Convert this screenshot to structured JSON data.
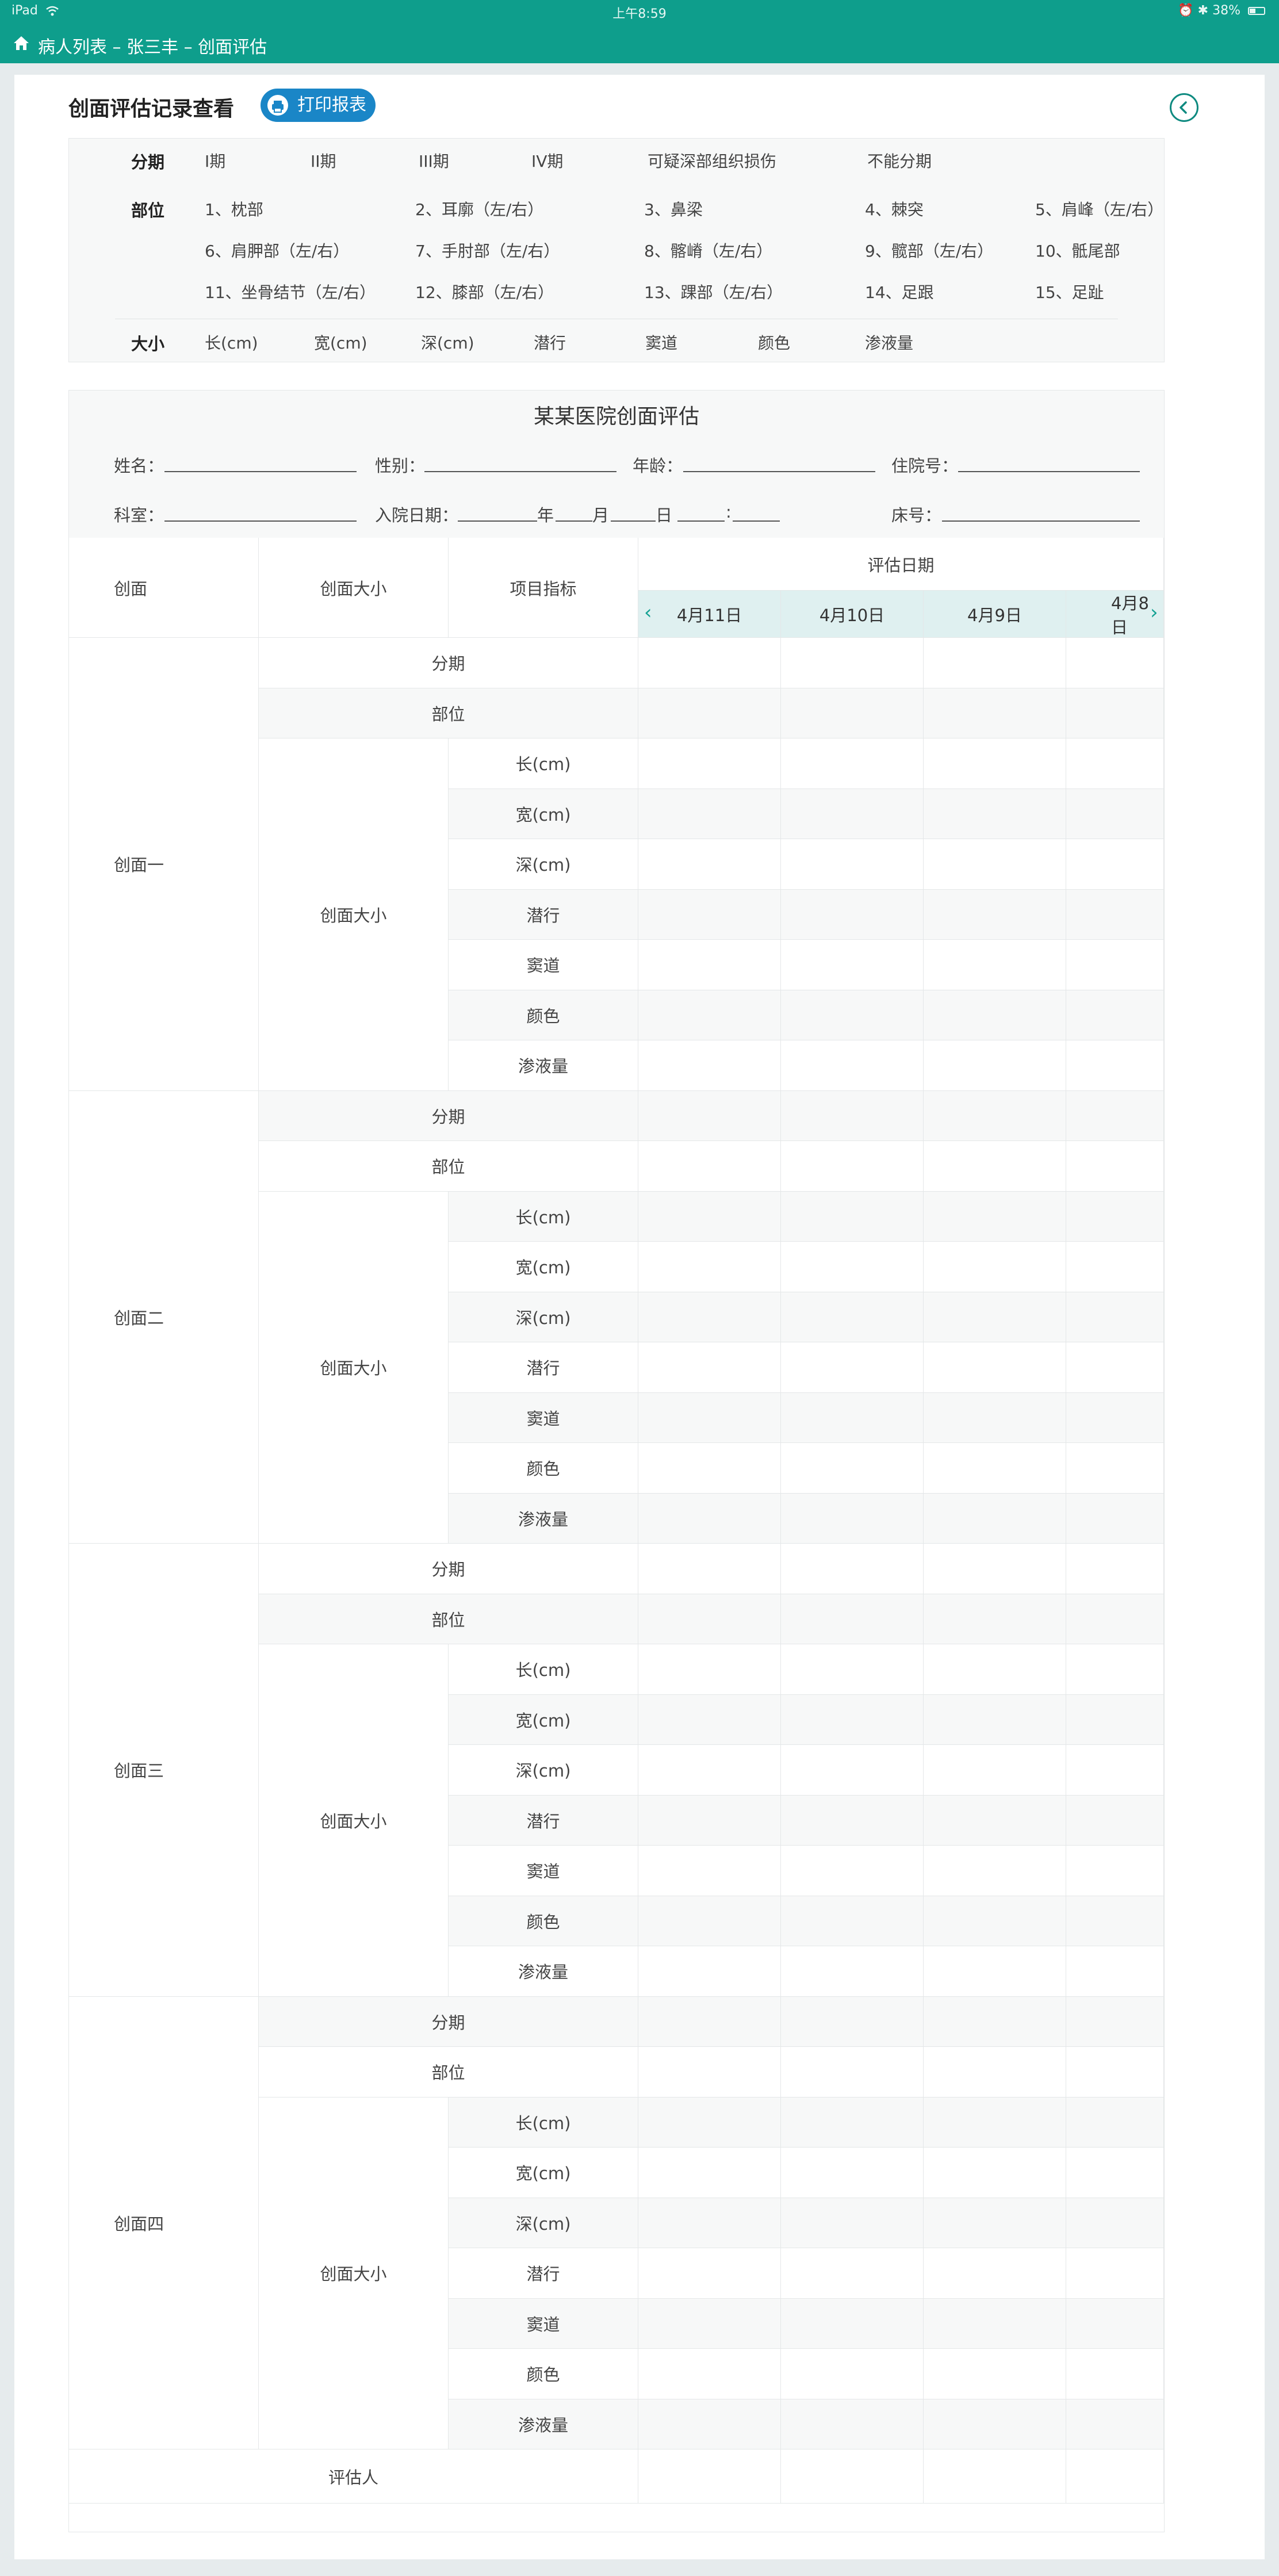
{
  "status_bar": {
    "device": "iPad",
    "time": "上午8:59",
    "battery": "38%",
    "wifi_icon": "wifi-icon",
    "battery_level": 0.38
  },
  "nav": {
    "breadcrumb": "病人列表 – 张三丰 – 创面评估",
    "home_icon": "home-icon"
  },
  "header": {
    "title": "创面评估记录查看",
    "print_label": "打印报表",
    "back_icon": "chevron-left-circle-icon"
  },
  "legend": {
    "stage_label": "分期",
    "stages": [
      "I期",
      "II期",
      "III期",
      "IV期",
      "可疑深部组织损伤",
      "不能分期"
    ],
    "site_label": "部位",
    "sites": [
      "1、枕部",
      "2、耳廓（左/右）",
      "3、鼻梁",
      "4、棘突",
      "5、肩峰（左/右）",
      "6、肩胛部（左/右）",
      "7、手肘部（左/右）",
      "8、髂嵴（左/右）",
      "9、髋部（左/右）",
      "10、骶尾部",
      "11、坐骨结节（左/右）",
      "12、膝部（左/右）",
      "13、踝部（左/右）",
      "14、足跟",
      "15、足趾"
    ],
    "size_label": "大小",
    "sizes": [
      "长(cm)",
      "宽(cm)",
      "深(cm)",
      "潜行",
      "窦道",
      "颜色",
      "渗液量"
    ]
  },
  "form": {
    "title": "某某医院创面评估",
    "name_label": "姓名：",
    "gender_label": "性别：",
    "age_label": "年龄：",
    "admission_no_label": "住院号：",
    "dept_label": "科室：",
    "admit_date_label": "入院日期：",
    "year": "年",
    "month": "月",
    "day": "日",
    "colon": ":",
    "bed_label": "床号："
  },
  "table": {
    "col_wound": "创面",
    "col_size": "创面大小",
    "col_item": "项目指标",
    "col_eval_date": "评估日期",
    "dates": [
      "4月11日",
      "4月10日",
      "4月9日",
      "4月8日"
    ],
    "row_stage": "分期",
    "row_site": "部位",
    "size_group": "创面大小",
    "size_items": [
      "长(cm)",
      "宽(cm)",
      "深(cm)",
      "潜行",
      "窦道",
      "颜色",
      "渗液量"
    ],
    "wounds": [
      "创面一",
      "创面二",
      "创面三",
      "创面四"
    ],
    "evaluator": "评估人"
  }
}
